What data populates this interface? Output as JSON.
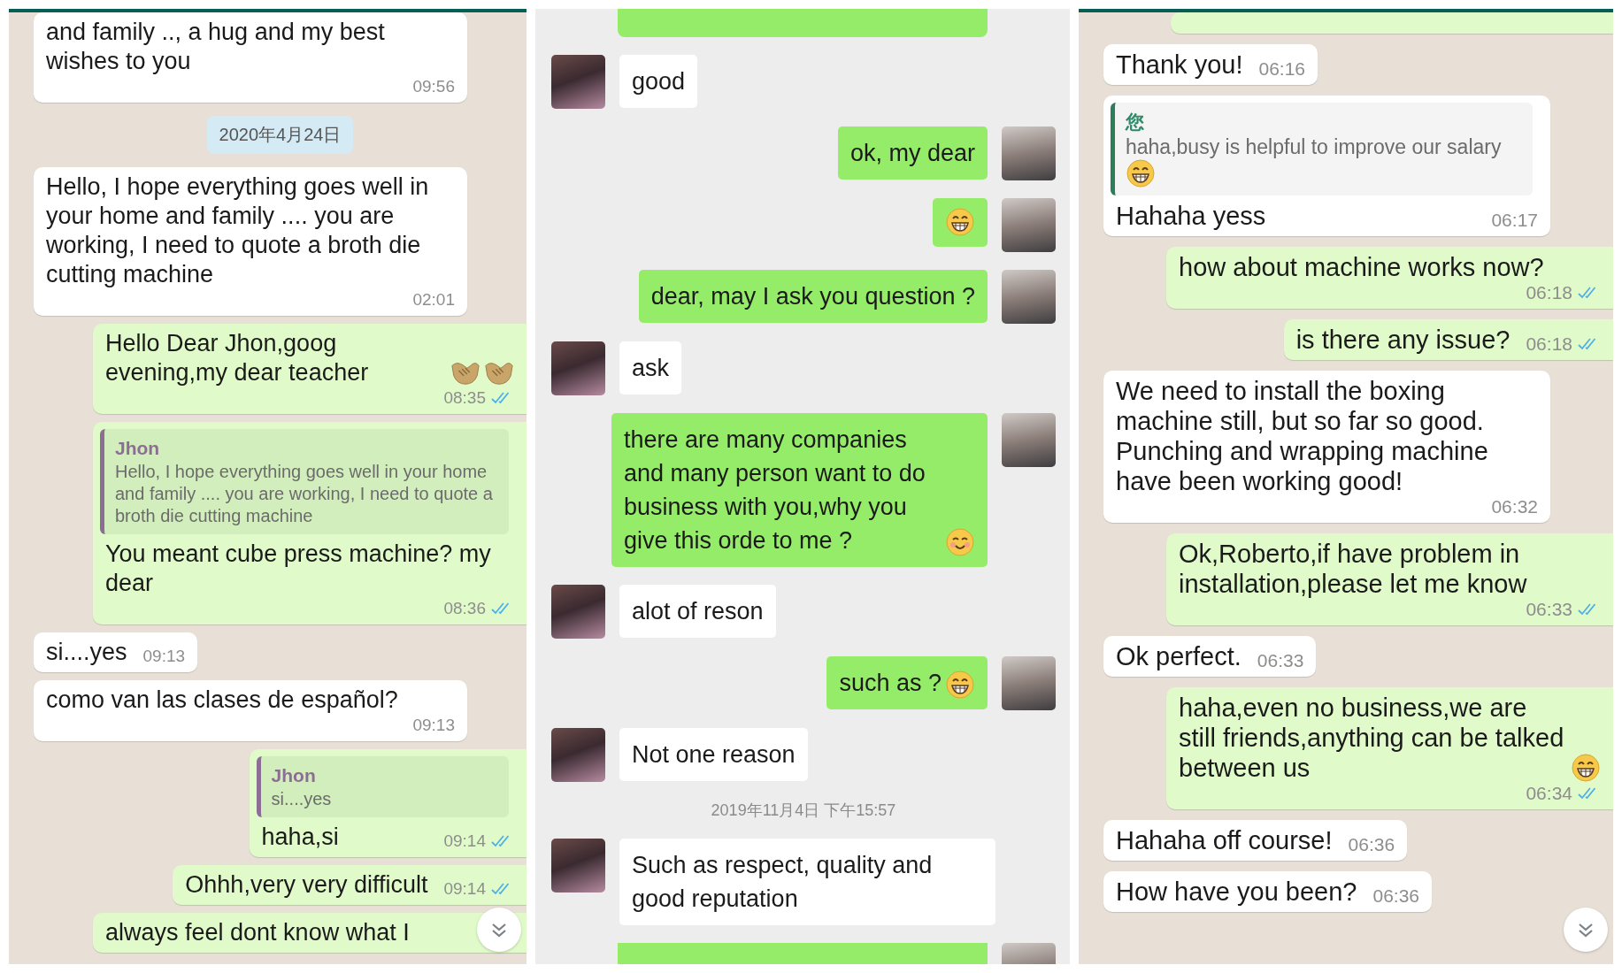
{
  "panels": [
    {
      "kind": "whatsapp",
      "scroll_button": true,
      "messages": [
        {
          "kind": "received",
          "text": "and family .., a hug and my best wishes to you",
          "time": "09:56"
        },
        {
          "kind": "date",
          "text": "2020年4月24日"
        },
        {
          "kind": "received",
          "text": "Hello, I hope everything goes well in your home and family .... you are working, I need to quote a broth die cutting machine",
          "time": "02:01"
        },
        {
          "kind": "sent",
          "text": "Hello Dear Jhon,goog evening,my dear teacher",
          "emojis": [
            {
              "kind": "handshake"
            },
            {
              "kind": "handshake"
            }
          ],
          "time": "08:35",
          "read": true
        },
        {
          "kind": "sent",
          "quote": {
            "author": "Jhon",
            "color": "#8c6e94",
            "text": "Hello, I hope everything goes well in your home and family .... you are working, I need to quote a broth die cutting machine"
          },
          "text": "You meant cube press machine? my dear",
          "time": "08:36",
          "read": true
        },
        {
          "kind": "received",
          "text": "si....yes",
          "time": "09:13"
        },
        {
          "kind": "received",
          "text": "como van las clases de español?",
          "time": "09:13"
        },
        {
          "kind": "sent",
          "quote": {
            "author": "Jhon",
            "color": "#8c6e94",
            "text": "si....yes"
          },
          "text": "haha,si",
          "time": "09:14",
          "read": true
        },
        {
          "kind": "sent",
          "text": "Ohhh,very very difficult",
          "time": "09:14",
          "read": true
        },
        {
          "kind": "sent",
          "text": "always feel dont know what I"
        }
      ]
    },
    {
      "kind": "wechat",
      "scroll_button": false,
      "messages": [
        {
          "kind": "stub-sent"
        },
        {
          "kind": "received",
          "text": "good"
        },
        {
          "kind": "sent",
          "text": "ok, my dear"
        },
        {
          "kind": "sent",
          "emojis": [
            {
              "kind": "grin"
            }
          ]
        },
        {
          "kind": "sent",
          "text": "dear, may I ask you question ?"
        },
        {
          "kind": "received",
          "text": "ask"
        },
        {
          "kind": "sent",
          "text": "there are many companies and many person want to do business with you,why you give this orde to me ?",
          "emojis": [
            {
              "kind": "smile"
            }
          ]
        },
        {
          "kind": "received",
          "text": "alot of reson"
        },
        {
          "kind": "sent",
          "text": "such as ?",
          "emojis": [
            {
              "kind": "grin"
            }
          ]
        },
        {
          "kind": "received",
          "text": "Not one reason"
        },
        {
          "kind": "date",
          "text": "2019年11月4日 下午15:57"
        },
        {
          "kind": "received",
          "text": "Such as respect, quality and good reputation"
        },
        {
          "kind": "stub-sent"
        }
      ]
    },
    {
      "kind": "whatsapp",
      "scroll_button": true,
      "messages": [
        {
          "kind": "stub-sent"
        },
        {
          "kind": "received",
          "text": "Thank you!",
          "time": "06:16"
        },
        {
          "kind": "received",
          "quote": {
            "author": "您",
            "color": "#2e8b6a",
            "text": "haha,busy is helpful to improve our salary",
            "emojis": [
              {
                "kind": "grin"
              }
            ]
          },
          "text": "Hahaha yess",
          "time": "06:17"
        },
        {
          "kind": "sent",
          "text": "how about machine works now?",
          "time": "06:18",
          "read": true
        },
        {
          "kind": "sent",
          "text": "is there any issue?",
          "time": "06:18",
          "read": true
        },
        {
          "kind": "received",
          "text": "We need to install the boxing machine still, but so far so good. Punching and wrapping machine have been working good!",
          "time": "06:32"
        },
        {
          "kind": "sent",
          "text": "Ok,Roberto,if have problem in installation,please let me know",
          "time": "06:33",
          "read": true
        },
        {
          "kind": "received",
          "text": "Ok perfect.",
          "time": "06:33"
        },
        {
          "kind": "sent",
          "text": "haha,even no business,we are still friends,anything can be talked between us",
          "emojis": [
            {
              "kind": "grin"
            }
          ],
          "time": "06:34",
          "read": true
        },
        {
          "kind": "received",
          "text": "Hahaha off course!",
          "time": "06:36"
        },
        {
          "kind": "received",
          "text": "How have you been?",
          "time": "06:36"
        }
      ]
    }
  ]
}
